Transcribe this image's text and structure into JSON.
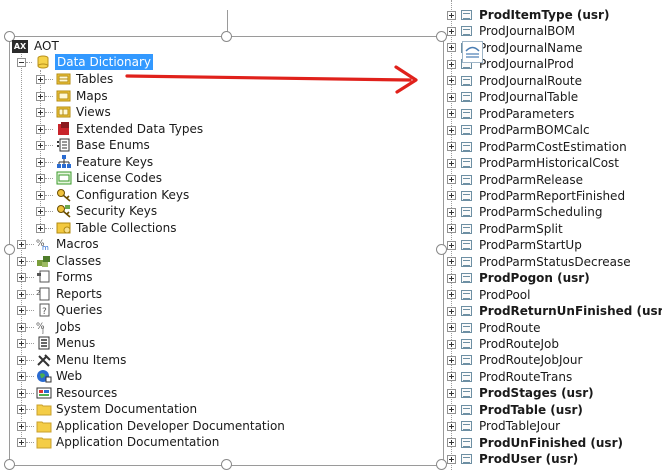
{
  "tree": {
    "root": {
      "label": "AOT",
      "logo_text": "AX",
      "icon": "ax-logo-icon"
    },
    "data_dictionary": {
      "label": "Data Dictionary",
      "icon": "database-icon"
    },
    "dd_children": [
      {
        "label": "Tables",
        "icon": "tables-folder-icon"
      },
      {
        "label": "Maps",
        "icon": "maps-folder-icon"
      },
      {
        "label": "Views",
        "icon": "views-folder-icon"
      },
      {
        "label": "Extended Data Types",
        "icon": "extended-data-types-icon"
      },
      {
        "label": "Base Enums",
        "icon": "base-enums-icon"
      },
      {
        "label": "Feature Keys",
        "icon": "feature-keys-icon"
      },
      {
        "label": "License Codes",
        "icon": "license-codes-icon"
      },
      {
        "label": "Configuration Keys",
        "icon": "configuration-keys-icon"
      },
      {
        "label": "Security Keys",
        "icon": "security-keys-icon"
      },
      {
        "label": "Table Collections",
        "icon": "table-collections-icon"
      }
    ],
    "top_nodes": [
      {
        "label": "Macros",
        "icon": "macros-icon"
      },
      {
        "label": "Classes",
        "icon": "classes-icon"
      },
      {
        "label": "Forms",
        "icon": "forms-icon"
      },
      {
        "label": "Reports",
        "icon": "reports-icon"
      },
      {
        "label": "Queries",
        "icon": "queries-icon"
      },
      {
        "label": "Jobs",
        "icon": "jobs-icon"
      },
      {
        "label": "Menus",
        "icon": "menus-icon"
      },
      {
        "label": "Menu Items",
        "icon": "menu-items-icon"
      },
      {
        "label": "Web",
        "icon": "web-icon"
      },
      {
        "label": "Resources",
        "icon": "resources-icon"
      },
      {
        "label": "System Documentation",
        "icon": "folder-icon"
      },
      {
        "label": "Application Developer Documentation",
        "icon": "folder-icon"
      },
      {
        "label": "Application Documentation",
        "icon": "folder-icon"
      }
    ]
  },
  "tables_list": [
    {
      "label": "ProdItemType (usr)",
      "bold": true
    },
    {
      "label": "ProdJournalBOM",
      "bold": false
    },
    {
      "label": "ProdJournalName",
      "bold": false
    },
    {
      "label": "ProdJournalProd",
      "bold": false
    },
    {
      "label": "ProdJournalRoute",
      "bold": false
    },
    {
      "label": "ProdJournalTable",
      "bold": false
    },
    {
      "label": "ProdParameters",
      "bold": false
    },
    {
      "label": "ProdParmBOMCalc",
      "bold": false
    },
    {
      "label": "ProdParmCostEstimation",
      "bold": false
    },
    {
      "label": "ProdParmHistoricalCost",
      "bold": false
    },
    {
      "label": "ProdParmRelease",
      "bold": false
    },
    {
      "label": "ProdParmReportFinished",
      "bold": false
    },
    {
      "label": "ProdParmScheduling",
      "bold": false
    },
    {
      "label": "ProdParmSplit",
      "bold": false
    },
    {
      "label": "ProdParmStartUp",
      "bold": false
    },
    {
      "label": "ProdParmStatusDecrease",
      "bold": false
    },
    {
      "label": "ProdPogon (usr)",
      "bold": true
    },
    {
      "label": "ProdPool",
      "bold": false
    },
    {
      "label": "ProdReturnUnFinished (usr)",
      "bold": true
    },
    {
      "label": "ProdRoute",
      "bold": false
    },
    {
      "label": "ProdRouteJob",
      "bold": false
    },
    {
      "label": "ProdRouteJobJour",
      "bold": false
    },
    {
      "label": "ProdRouteTrans",
      "bold": false
    },
    {
      "label": "ProdStages (usr)",
      "bold": true
    },
    {
      "label": "ProdTable (usr)",
      "bold": true
    },
    {
      "label": "ProdTableJour",
      "bold": false
    },
    {
      "label": "ProdUnFinished (usr)",
      "bold": true
    },
    {
      "label": "ProdUser (usr)",
      "bold": true
    }
  ],
  "colors": {
    "selection": "#3399ff",
    "arrow": "#e0211b",
    "frame": "#9a9a9a"
  }
}
